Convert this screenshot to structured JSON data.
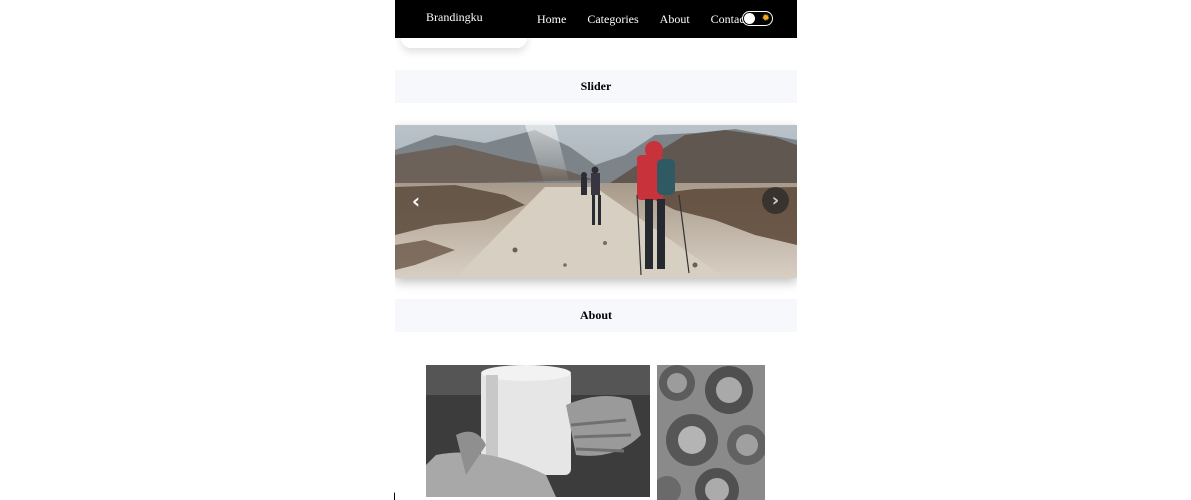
{
  "navbar": {
    "brand": "Brandingku",
    "links": [
      "Home",
      "Categories",
      "About",
      "Contact"
    ],
    "theme_toggle_icon": "sun-icon",
    "sun_glyph": "✹"
  },
  "sections": {
    "slider_title": "Slider",
    "about_title": "About"
  },
  "slider": {
    "prev_icon": "chevron-left-icon",
    "next_icon": "chevron-right-icon",
    "prev_glyph": "‹",
    "next_glyph": "›",
    "image": "trekkers-mountain-trail"
  },
  "about": {
    "images": [
      "hands-holding-mug",
      "plates-tabletop"
    ]
  },
  "colors": {
    "navbar_bg": "#000000",
    "section_bg": "#f7f8fc",
    "accent_sun": "#f5a623"
  }
}
